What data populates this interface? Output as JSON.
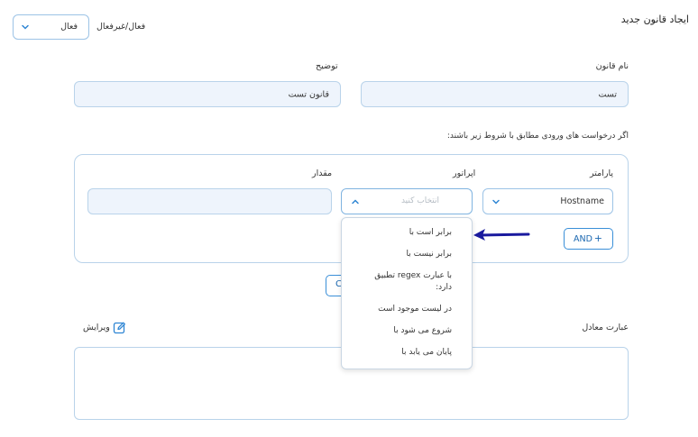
{
  "header": {
    "title": "ایجاد قانون جدید",
    "status_label": "فعال/غیرفعال",
    "status_value": "فعال"
  },
  "form": {
    "name_label": "نام قانون",
    "name_value": "تست",
    "desc_label": "توضیح",
    "desc_value": "قانون تست",
    "condition_intro": "اگر درخواست های ورودی مطابق با شروط زیر باشند:"
  },
  "condition": {
    "param_label": "پارامتر",
    "param_value": "Hostname",
    "operator_label": "اپراتور",
    "operator_placeholder": "انتخاب کنید",
    "value_label": "مقدار",
    "and_label": "AND",
    "operator_options": [
      "برابر است با",
      "برابر نیست با",
      "با عبارت regex تطبیق دارد:",
      "در لیست موجود است",
      "شروع می شود با",
      "پایان می یابد با"
    ]
  },
  "expression": {
    "label": "عبارت معادل",
    "edit_label": "ویرایش"
  },
  "colors": {
    "accent": "#2f86d4",
    "arrow": "#1a1a9e",
    "field_bg": "#eef4fc",
    "field_border": "#b9d3ea"
  }
}
